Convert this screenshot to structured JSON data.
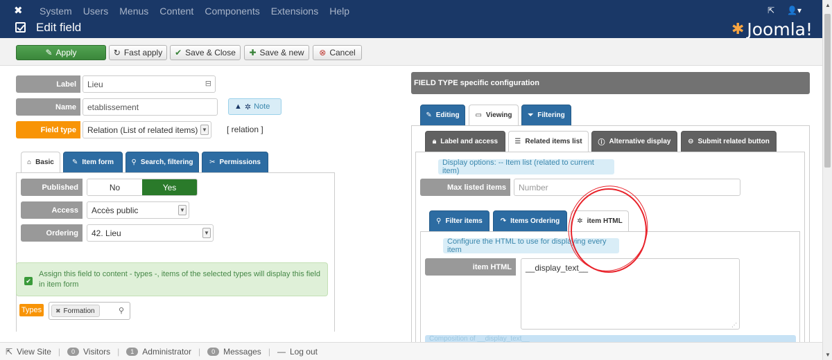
{
  "nav": {
    "menu": [
      "System",
      "Users",
      "Menus",
      "Content",
      "Components",
      "Extensions",
      "Help"
    ],
    "external_icon": "external-link-icon",
    "user_icon": "user-icon"
  },
  "header": {
    "title": "Edit field",
    "brand": "Joomla!"
  },
  "toolbar": {
    "apply": "Apply",
    "fast_apply": "Fast apply",
    "save_close": "Save & Close",
    "save_new": "Save & new",
    "cancel": "Cancel"
  },
  "form": {
    "label_label": "Label",
    "label_value": "Lieu",
    "name_label": "Name",
    "name_value": "etablissement",
    "fieldtype_label": "Field type",
    "fieldtype_value": "Relation (List of related items)",
    "fieldtype_tag": "[ relation ]",
    "note": "Note"
  },
  "left_tabs": [
    "Basic",
    "Item form",
    "Search, filtering",
    "Permissions"
  ],
  "basic": {
    "published_label": "Published",
    "no": "No",
    "yes": "Yes",
    "access_label": "Access",
    "access_value": "Accès public",
    "ordering_label": "Ordering",
    "ordering_value": "42. Lieu",
    "assign_text": "Assign this field to content - types -, items of the selected types will display this field in item form",
    "types_label": "Types",
    "types_chip": "Formation"
  },
  "right": {
    "header": "FIELD TYPE specific configuration",
    "tabs": [
      "Editing",
      "Viewing",
      "Filtering"
    ],
    "subtabs": [
      "Label and access",
      "Related items list",
      "Alternative display",
      "Submit related button"
    ],
    "display_options": "Display options: -- Item list (related to current item)",
    "max_label": "Max listed items",
    "max_placeholder": "Number",
    "inner_tabs": [
      "Filter items",
      "Items Ordering",
      "item HTML"
    ],
    "configure_text": "Configure the HTML to use for displaying every item",
    "itemhtml_label": "item HTML",
    "itemhtml_value": "__display_text__",
    "composition": "Composition of __display_text__"
  },
  "status": {
    "view_site": "View Site",
    "visitors_count": "0",
    "visitors": "Visitors",
    "admin_count": "1",
    "admin": "Administrator",
    "messages_count": "0",
    "messages": "Messages",
    "logout": "Log out"
  }
}
